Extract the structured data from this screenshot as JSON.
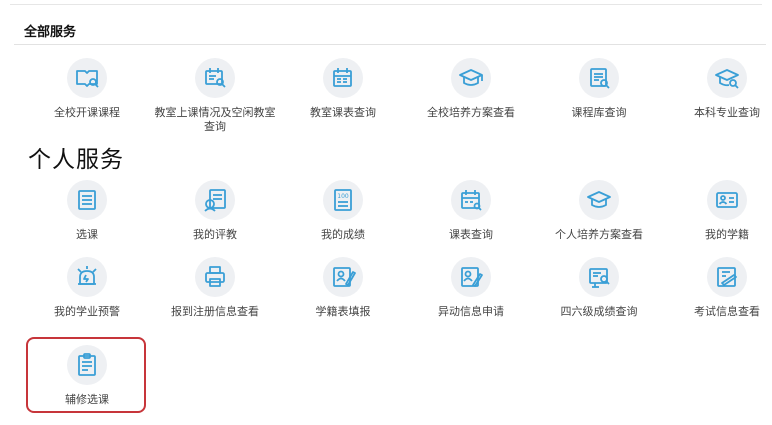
{
  "all_services": {
    "title": "全部服务",
    "items": [
      {
        "label": "全校开课课程",
        "icon": "open-book-search-icon"
      },
      {
        "label": "教室上课情况及空闲教室查询",
        "icon": "classroom-search-icon"
      },
      {
        "label": "教室课表查询",
        "icon": "calendar-search-icon"
      },
      {
        "label": "全校培养方案查看",
        "icon": "graduation-cap-icon"
      },
      {
        "label": "课程库查询",
        "icon": "document-search-icon"
      },
      {
        "label": "本科专业查询",
        "icon": "graduation-cap-search-icon"
      }
    ]
  },
  "personal_services": {
    "title": "个人服务",
    "rows": [
      [
        {
          "label": "选课",
          "icon": "course-select-icon"
        },
        {
          "label": "我的评教",
          "icon": "evaluation-icon"
        },
        {
          "label": "我的成绩",
          "icon": "score-100-icon"
        },
        {
          "label": "课表查询",
          "icon": "timetable-search-icon"
        },
        {
          "label": "个人培养方案查看",
          "icon": "graduation-cap-icon"
        },
        {
          "label": "我的学籍",
          "icon": "id-card-icon"
        }
      ],
      [
        {
          "label": "我的学业预警",
          "icon": "alarm-clock-icon"
        },
        {
          "label": "报到注册信息查看",
          "icon": "printer-icon"
        },
        {
          "label": "学籍表填报",
          "icon": "form-edit-icon"
        },
        {
          "label": "异动信息申请",
          "icon": "application-edit-icon"
        },
        {
          "label": "四六级成绩查询",
          "icon": "exam-search-icon"
        },
        {
          "label": "考试信息查看",
          "icon": "exam-info-icon"
        }
      ],
      [
        {
          "label": "辅修选课",
          "icon": "minor-course-icon"
        }
      ]
    ]
  },
  "colors": {
    "icon_stroke": "#3a9fd6",
    "icon_bg": "#eef0f3",
    "highlight_border": "#c7353a"
  }
}
